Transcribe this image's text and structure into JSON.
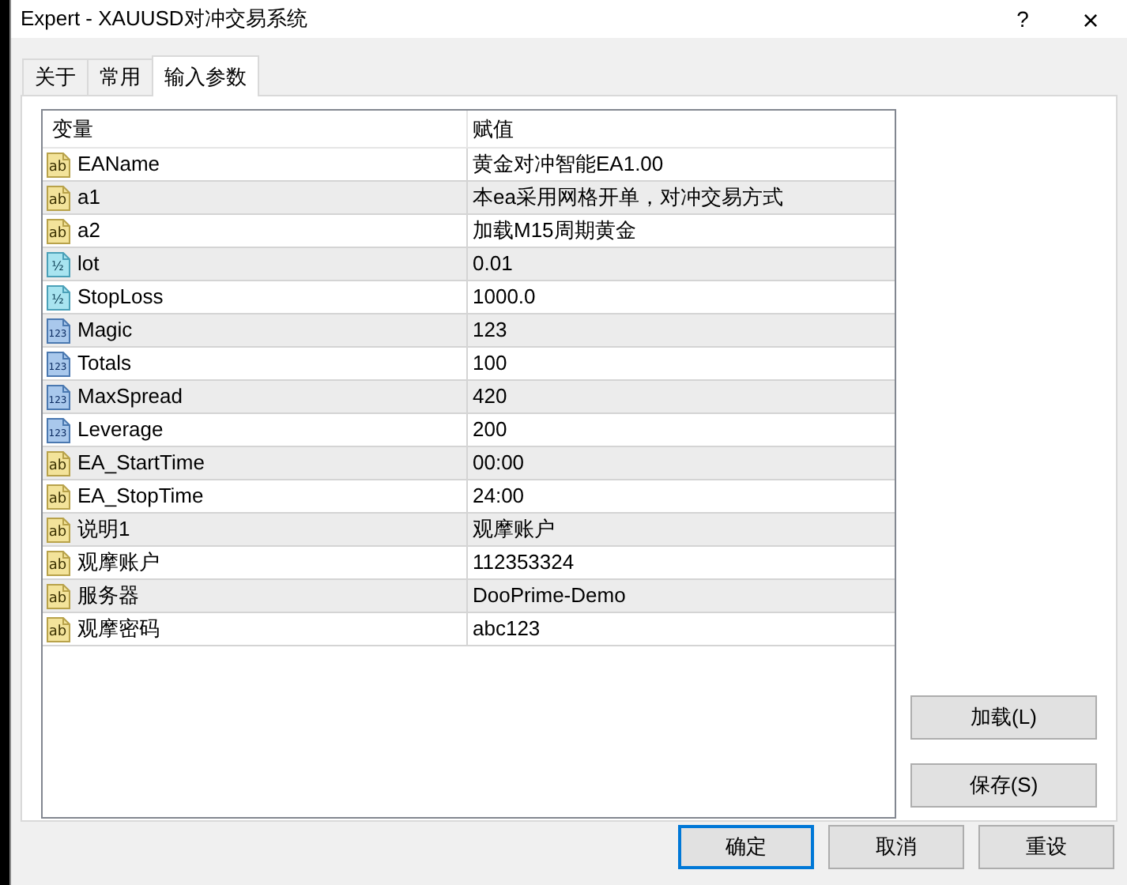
{
  "window": {
    "title": "Expert - XAUUSD对冲交易系统",
    "help": "?",
    "close": "×"
  },
  "tabs": [
    {
      "label": "关于",
      "selected": false
    },
    {
      "label": "常用",
      "selected": false
    },
    {
      "label": "输入参数",
      "selected": true
    }
  ],
  "table": {
    "columns": [
      "变量",
      "赋值"
    ],
    "rows": [
      {
        "kind": "string",
        "icon": "ab",
        "name": "EAName",
        "value": "黄金对冲智能EA1.00"
      },
      {
        "kind": "string",
        "icon": "ab",
        "name": "a1",
        "value": "本ea采用网格开单，对冲交易方式"
      },
      {
        "kind": "string",
        "icon": "ab",
        "name": "a2",
        "value": "加载M15周期黄金"
      },
      {
        "kind": "double",
        "icon": "½",
        "name": "lot",
        "value": "0.01"
      },
      {
        "kind": "double",
        "icon": "½",
        "name": "StopLoss",
        "value": "1000.0"
      },
      {
        "kind": "int",
        "icon": "123",
        "name": "Magic",
        "value": "123"
      },
      {
        "kind": "int",
        "icon": "123",
        "name": "Totals",
        "value": "100"
      },
      {
        "kind": "int",
        "icon": "123",
        "name": "MaxSpread",
        "value": "420"
      },
      {
        "kind": "int",
        "icon": "123",
        "name": "Leverage",
        "value": "200"
      },
      {
        "kind": "string",
        "icon": "ab",
        "name": "EA_StartTime",
        "value": "00:00"
      },
      {
        "kind": "string",
        "icon": "ab",
        "name": "EA_StopTime",
        "value": "24:00"
      },
      {
        "kind": "string",
        "icon": "ab",
        "name": "说明1",
        "value": "观摩账户"
      },
      {
        "kind": "string",
        "icon": "ab",
        "name": "观摩账户",
        "value": "112353324"
      },
      {
        "kind": "string",
        "icon": "ab",
        "name": "服务器",
        "value": "DooPrime-Demo"
      },
      {
        "kind": "string",
        "icon": "ab",
        "name": "观摩密码",
        "value": "abc123"
      }
    ]
  },
  "side_buttons": [
    "加载(L)",
    "保存(S)"
  ],
  "buttons": [
    {
      "label": "确定",
      "default": true
    },
    {
      "label": "取消",
      "default": false
    },
    {
      "label": "重设",
      "default": false
    }
  ]
}
